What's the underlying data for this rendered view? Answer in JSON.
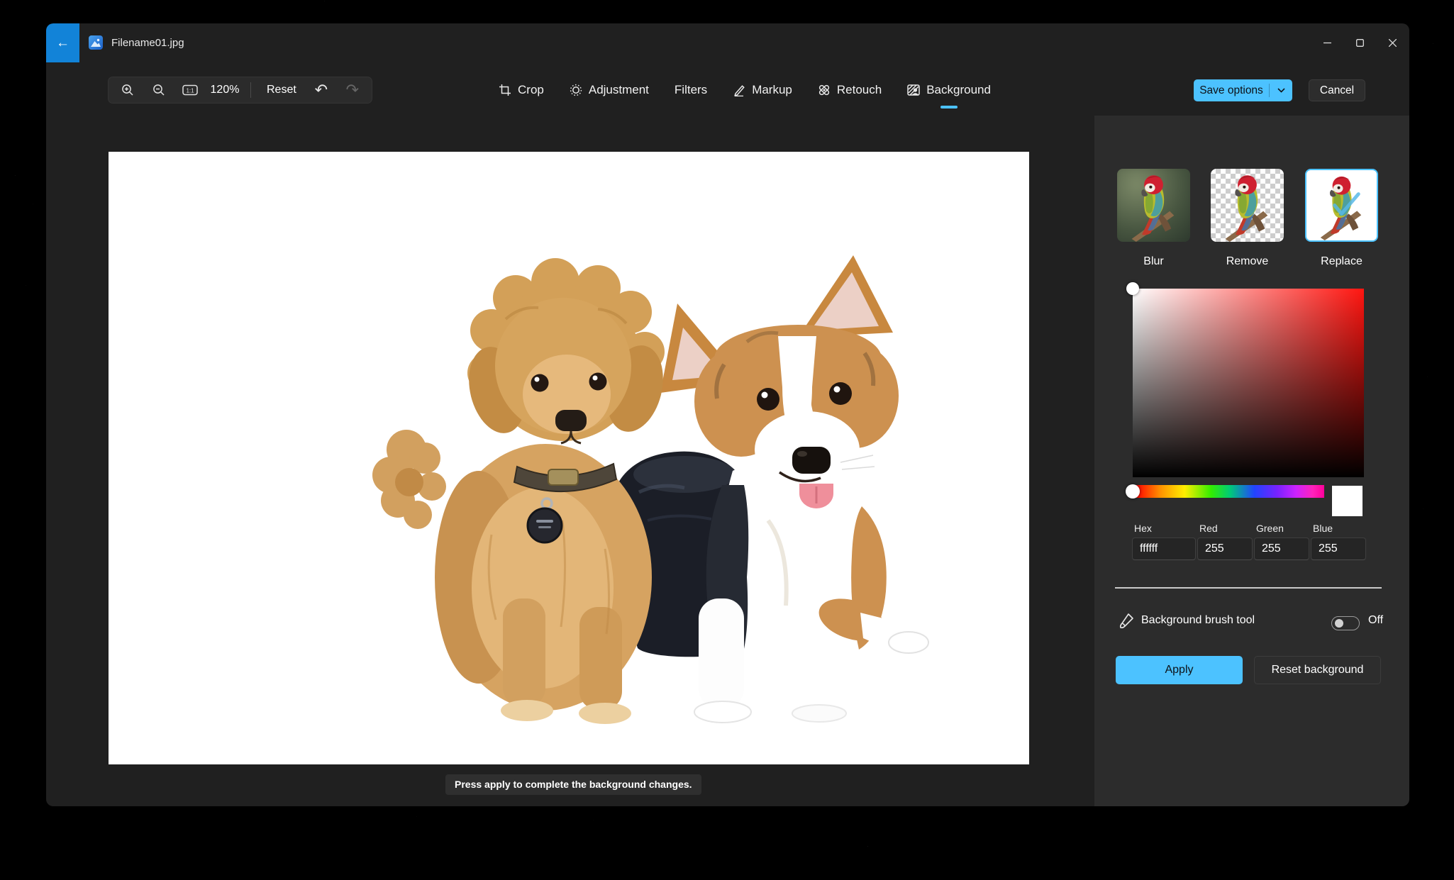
{
  "window": {
    "title": "Filename01.jpg"
  },
  "toolbar": {
    "zoom_level": "120%",
    "actual_size": "1:1",
    "reset_label": "Reset"
  },
  "tabs": [
    {
      "label": "Crop",
      "icon": "crop-icon"
    },
    {
      "label": "Adjustment",
      "icon": "adjustment-icon"
    },
    {
      "label": "Filters"
    },
    {
      "label": "Markup",
      "icon": "markup-icon"
    },
    {
      "label": "Retouch",
      "icon": "retouch-icon"
    },
    {
      "label": "Background",
      "icon": "background-icon",
      "active": true
    }
  ],
  "actions": {
    "save_options": "Save options",
    "cancel": "Cancel"
  },
  "background_panel": {
    "modes": [
      {
        "label": "Blur"
      },
      {
        "label": "Remove"
      },
      {
        "label": "Replace",
        "selected": true
      }
    ],
    "fields": {
      "hex_label": "Hex",
      "red_label": "Red",
      "green_label": "Green",
      "blue_label": "Blue",
      "hex": "ffffff",
      "red": "255",
      "green": "255",
      "blue": "255"
    },
    "selected_color": "#ffffff",
    "brush": {
      "label": "Background brush tool",
      "state": "Off"
    },
    "apply_label": "Apply",
    "reset_label": "Reset background"
  },
  "canvas": {
    "tooltip": "Press apply to complete the background changes."
  },
  "colors": {
    "accent": "#4cc2ff",
    "back_button": "#1283d8",
    "tab_underline": "#4cc2ff",
    "panel_bg": "#2c2c2c"
  }
}
